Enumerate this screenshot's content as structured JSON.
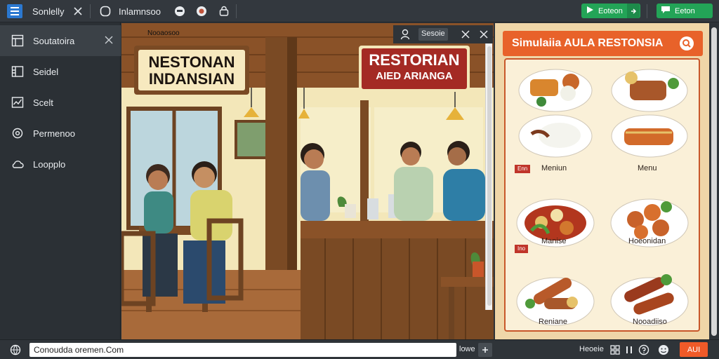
{
  "topbar": {
    "tab1_label": "Sonlelly",
    "tab2_label": "Inlamnsoo",
    "btn_primary_label": "Eoteon",
    "btn_secondary_label": "Eeton"
  },
  "sidebar": {
    "items": [
      {
        "label": "Soutatoira"
      },
      {
        "label": "Seidel"
      },
      {
        "label": "Scelt"
      },
      {
        "label": "Permenoo"
      },
      {
        "label": "Loopplo"
      }
    ]
  },
  "scene": {
    "caption": "Nooaosoo",
    "sign_left_line1": "NESTONAN",
    "sign_left_line2": "INDANSIAN",
    "sign_right_line1": "RESTORIAN",
    "sign_right_line2": "AIED ARIANGA"
  },
  "overlay": {
    "label": "Sesoie"
  },
  "menu_panel": {
    "title": "Simulaiia AULA RESTONSIA",
    "badge_mid_left": "Enn",
    "label_mid_left": "Meniun",
    "label_mid_right": "Menu",
    "badge_low_left": "Ino",
    "label_row3_left": "Manise",
    "label_row3_right": "Hoeonidan",
    "label_row4_left": "Reniane",
    "label_row4_right": "Nooadiiso"
  },
  "bottombar": {
    "address_value": "Conoudda oremen.Com",
    "text1": "lowe",
    "text2": "Heoeie",
    "btn_label": "AUI"
  },
  "colors": {
    "accent_green": "#23a457",
    "accent_orange": "#f05a28",
    "banner_orange": "#e8622a",
    "wood": "#7a4a24"
  }
}
